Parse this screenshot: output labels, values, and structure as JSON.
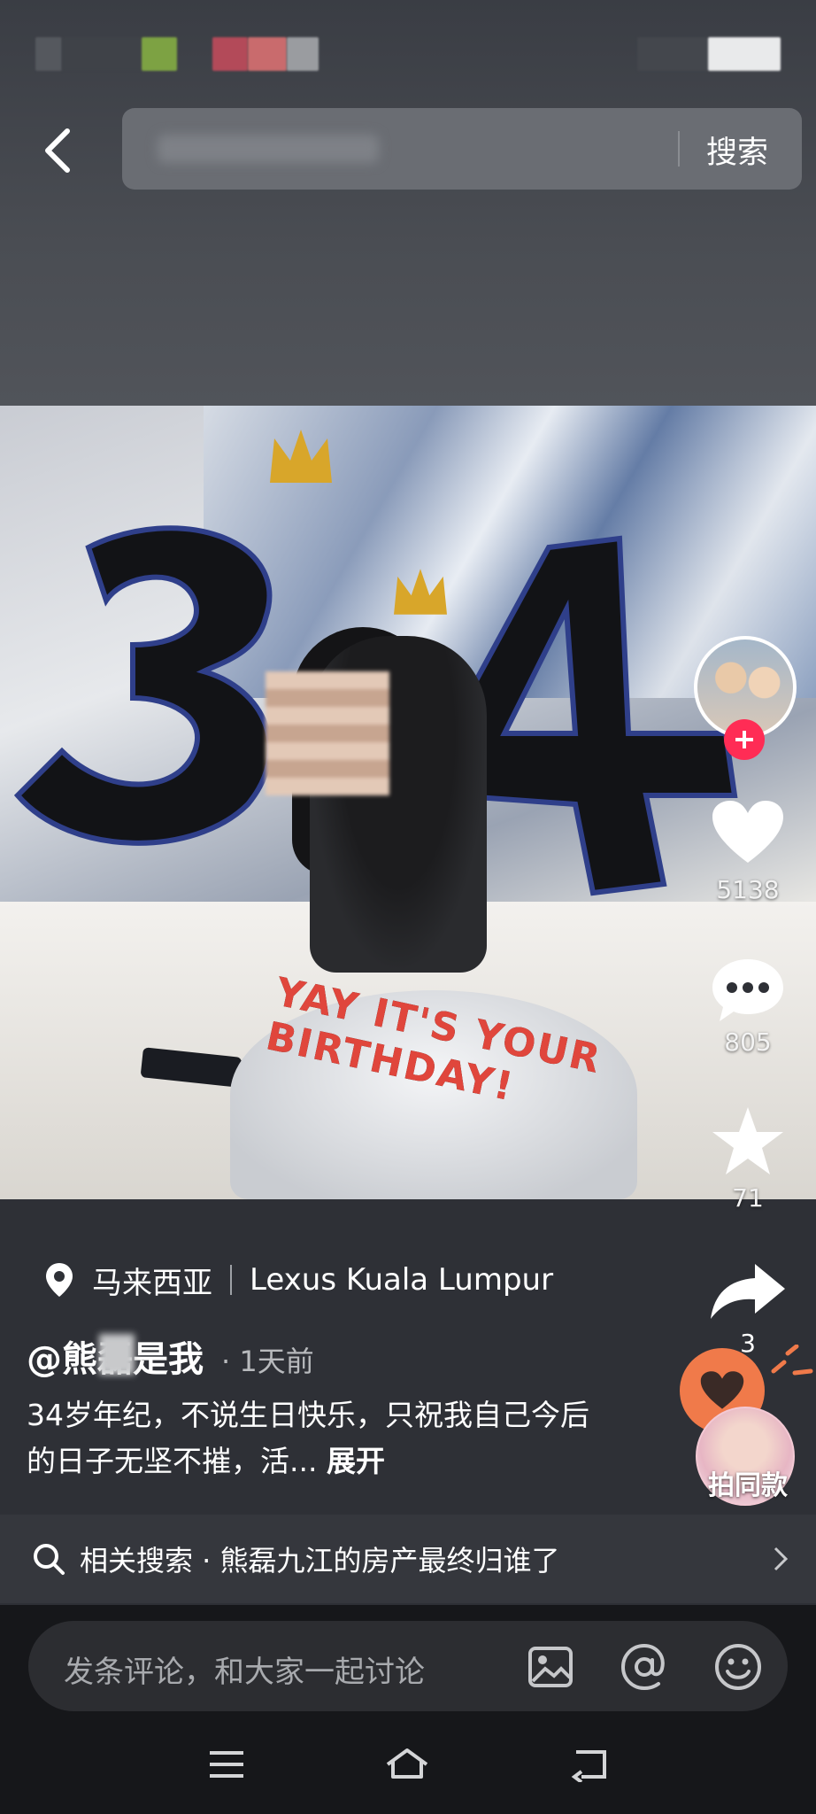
{
  "header": {
    "search_button": "搜索"
  },
  "right_rail": {
    "likes": "5138",
    "comments": "805",
    "favorites": "71",
    "shares": "3",
    "template_label": "拍同款"
  },
  "post": {
    "location": "马来西亚",
    "venue": "Lexus Kuala Lumpur",
    "author": "@熊磊是我",
    "time": "· 1天前",
    "description_part1": "34岁",
    "description_part2": "年纪，不说生日快乐，只祝我自己今后的日子无坚不摧，活...",
    "expand": "展开",
    "photo_text": "YAY IT'S YOUR BIRTHDAY!"
  },
  "related": {
    "text": "相关搜索 · 熊磊九江的房产最终归谁了"
  },
  "comment": {
    "placeholder": "发条评论，和大家一起讨论"
  },
  "colors": {
    "follow": "#ff2c55",
    "favorite_bubble": "#f07a4a"
  }
}
